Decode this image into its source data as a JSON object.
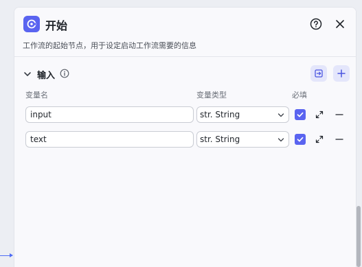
{
  "node": {
    "title": "开始",
    "description": "工作流的起始节点，用于设定启动工作流需要的信息",
    "icon": "start-node-icon",
    "accent": "#5a64f0"
  },
  "header": {
    "help_icon": "help-circle-icon",
    "close_icon": "close-icon"
  },
  "inputs": {
    "section_title": "输入",
    "columns": {
      "name": "变量名",
      "type": "变量类型",
      "required": "必填"
    },
    "rows": [
      {
        "name": "input",
        "type": "str. String",
        "required": true
      },
      {
        "name": "text",
        "type": "str. String",
        "required": true
      }
    ]
  }
}
